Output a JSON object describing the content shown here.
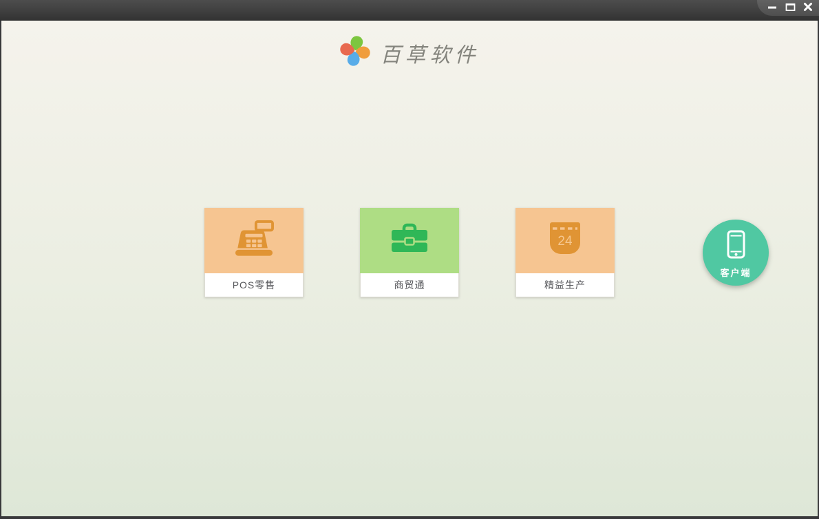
{
  "titlebar": {
    "controls": [
      {
        "name": "minimize"
      },
      {
        "name": "maximize"
      },
      {
        "name": "close"
      }
    ]
  },
  "header": {
    "app_name": "百草软件",
    "logo_petal_colors": {
      "top": "#7cc63f",
      "right": "#f09d3d",
      "bottom": "#58ace8",
      "left": "#e8694f"
    }
  },
  "products": [
    {
      "label": "POS零售",
      "icon": "cash-register-icon",
      "card_bg": "#f6c591",
      "icon_color": "#e09434"
    },
    {
      "label": "商贸通",
      "icon": "briefcase-icon",
      "card_bg": "#aedd84",
      "icon_color": "#2fb757"
    },
    {
      "label": "精益生产",
      "icon": "calendar-icon",
      "calendar_day": "24",
      "card_bg": "#f6c591",
      "icon_color": "#e09434"
    }
  ],
  "client_button": {
    "label": "客户端",
    "icon": "smartphone-icon",
    "bg": "#50c8a2"
  },
  "colors": {
    "titlebar": "#3f3f3f",
    "content_top": "#f5f3ec",
    "content_bottom": "#dee7d7",
    "card_label_text": "#55565a",
    "logo_text": "#84847d"
  }
}
